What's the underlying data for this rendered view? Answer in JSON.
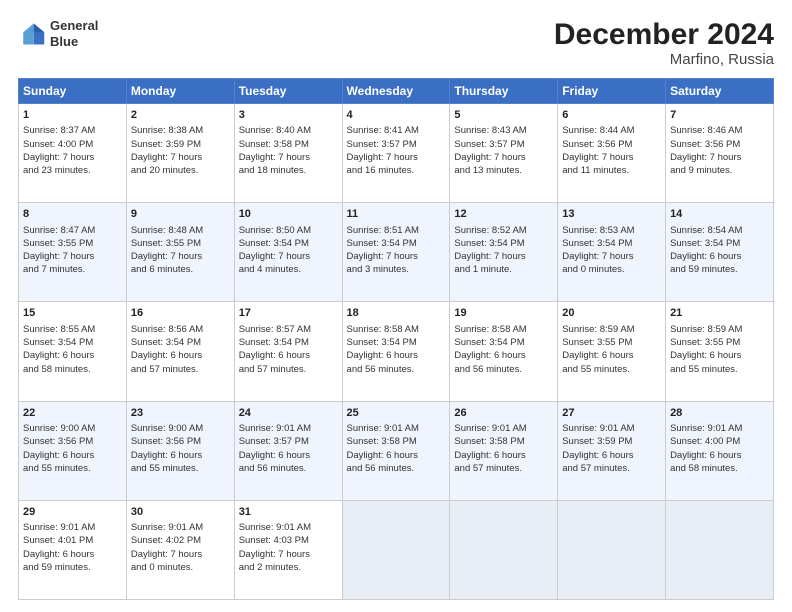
{
  "header": {
    "logo_line1": "General",
    "logo_line2": "Blue",
    "title": "December 2024",
    "subtitle": "Marfino, Russia"
  },
  "days_of_week": [
    "Sunday",
    "Monday",
    "Tuesday",
    "Wednesday",
    "Thursday",
    "Friday",
    "Saturday"
  ],
  "weeks": [
    [
      {
        "day": "1",
        "lines": [
          "Sunrise: 8:37 AM",
          "Sunset: 4:00 PM",
          "Daylight: 7 hours",
          "and 23 minutes."
        ]
      },
      {
        "day": "2",
        "lines": [
          "Sunrise: 8:38 AM",
          "Sunset: 3:59 PM",
          "Daylight: 7 hours",
          "and 20 minutes."
        ]
      },
      {
        "day": "3",
        "lines": [
          "Sunrise: 8:40 AM",
          "Sunset: 3:58 PM",
          "Daylight: 7 hours",
          "and 18 minutes."
        ]
      },
      {
        "day": "4",
        "lines": [
          "Sunrise: 8:41 AM",
          "Sunset: 3:57 PM",
          "Daylight: 7 hours",
          "and 16 minutes."
        ]
      },
      {
        "day": "5",
        "lines": [
          "Sunrise: 8:43 AM",
          "Sunset: 3:57 PM",
          "Daylight: 7 hours",
          "and 13 minutes."
        ]
      },
      {
        "day": "6",
        "lines": [
          "Sunrise: 8:44 AM",
          "Sunset: 3:56 PM",
          "Daylight: 7 hours",
          "and 11 minutes."
        ]
      },
      {
        "day": "7",
        "lines": [
          "Sunrise: 8:46 AM",
          "Sunset: 3:56 PM",
          "Daylight: 7 hours",
          "and 9 minutes."
        ]
      }
    ],
    [
      {
        "day": "8",
        "lines": [
          "Sunrise: 8:47 AM",
          "Sunset: 3:55 PM",
          "Daylight: 7 hours",
          "and 7 minutes."
        ]
      },
      {
        "day": "9",
        "lines": [
          "Sunrise: 8:48 AM",
          "Sunset: 3:55 PM",
          "Daylight: 7 hours",
          "and 6 minutes."
        ]
      },
      {
        "day": "10",
        "lines": [
          "Sunrise: 8:50 AM",
          "Sunset: 3:54 PM",
          "Daylight: 7 hours",
          "and 4 minutes."
        ]
      },
      {
        "day": "11",
        "lines": [
          "Sunrise: 8:51 AM",
          "Sunset: 3:54 PM",
          "Daylight: 7 hours",
          "and 3 minutes."
        ]
      },
      {
        "day": "12",
        "lines": [
          "Sunrise: 8:52 AM",
          "Sunset: 3:54 PM",
          "Daylight: 7 hours",
          "and 1 minute."
        ]
      },
      {
        "day": "13",
        "lines": [
          "Sunrise: 8:53 AM",
          "Sunset: 3:54 PM",
          "Daylight: 7 hours",
          "and 0 minutes."
        ]
      },
      {
        "day": "14",
        "lines": [
          "Sunrise: 8:54 AM",
          "Sunset: 3:54 PM",
          "Daylight: 6 hours",
          "and 59 minutes."
        ]
      }
    ],
    [
      {
        "day": "15",
        "lines": [
          "Sunrise: 8:55 AM",
          "Sunset: 3:54 PM",
          "Daylight: 6 hours",
          "and 58 minutes."
        ]
      },
      {
        "day": "16",
        "lines": [
          "Sunrise: 8:56 AM",
          "Sunset: 3:54 PM",
          "Daylight: 6 hours",
          "and 57 minutes."
        ]
      },
      {
        "day": "17",
        "lines": [
          "Sunrise: 8:57 AM",
          "Sunset: 3:54 PM",
          "Daylight: 6 hours",
          "and 57 minutes."
        ]
      },
      {
        "day": "18",
        "lines": [
          "Sunrise: 8:58 AM",
          "Sunset: 3:54 PM",
          "Daylight: 6 hours",
          "and 56 minutes."
        ]
      },
      {
        "day": "19",
        "lines": [
          "Sunrise: 8:58 AM",
          "Sunset: 3:54 PM",
          "Daylight: 6 hours",
          "and 56 minutes."
        ]
      },
      {
        "day": "20",
        "lines": [
          "Sunrise: 8:59 AM",
          "Sunset: 3:55 PM",
          "Daylight: 6 hours",
          "and 55 minutes."
        ]
      },
      {
        "day": "21",
        "lines": [
          "Sunrise: 8:59 AM",
          "Sunset: 3:55 PM",
          "Daylight: 6 hours",
          "and 55 minutes."
        ]
      }
    ],
    [
      {
        "day": "22",
        "lines": [
          "Sunrise: 9:00 AM",
          "Sunset: 3:56 PM",
          "Daylight: 6 hours",
          "and 55 minutes."
        ]
      },
      {
        "day": "23",
        "lines": [
          "Sunrise: 9:00 AM",
          "Sunset: 3:56 PM",
          "Daylight: 6 hours",
          "and 55 minutes."
        ]
      },
      {
        "day": "24",
        "lines": [
          "Sunrise: 9:01 AM",
          "Sunset: 3:57 PM",
          "Daylight: 6 hours",
          "and 56 minutes."
        ]
      },
      {
        "day": "25",
        "lines": [
          "Sunrise: 9:01 AM",
          "Sunset: 3:58 PM",
          "Daylight: 6 hours",
          "and 56 minutes."
        ]
      },
      {
        "day": "26",
        "lines": [
          "Sunrise: 9:01 AM",
          "Sunset: 3:58 PM",
          "Daylight: 6 hours",
          "and 57 minutes."
        ]
      },
      {
        "day": "27",
        "lines": [
          "Sunrise: 9:01 AM",
          "Sunset: 3:59 PM",
          "Daylight: 6 hours",
          "and 57 minutes."
        ]
      },
      {
        "day": "28",
        "lines": [
          "Sunrise: 9:01 AM",
          "Sunset: 4:00 PM",
          "Daylight: 6 hours",
          "and 58 minutes."
        ]
      }
    ],
    [
      {
        "day": "29",
        "lines": [
          "Sunrise: 9:01 AM",
          "Sunset: 4:01 PM",
          "Daylight: 6 hours",
          "and 59 minutes."
        ]
      },
      {
        "day": "30",
        "lines": [
          "Sunrise: 9:01 AM",
          "Sunset: 4:02 PM",
          "Daylight: 7 hours",
          "and 0 minutes."
        ]
      },
      {
        "day": "31",
        "lines": [
          "Sunrise: 9:01 AM",
          "Sunset: 4:03 PM",
          "Daylight: 7 hours",
          "and 2 minutes."
        ]
      },
      null,
      null,
      null,
      null
    ]
  ]
}
